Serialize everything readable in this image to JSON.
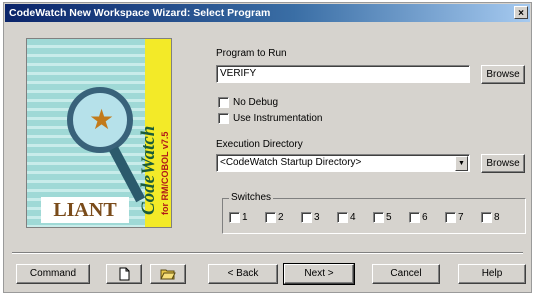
{
  "window": {
    "title": "CodeWatch New Workspace Wizard: Select Program",
    "close_glyph": "×"
  },
  "logo": {
    "brand": "LIANT",
    "product": "CodeWatch",
    "subtitle": "for RM/COBOL v7.5"
  },
  "program": {
    "label": "Program to Run",
    "value": "VERIFY",
    "browse_label": "Browse"
  },
  "options": {
    "no_debug_label": "No Debug",
    "no_debug_checked": false,
    "use_instrumentation_label": "Use Instrumentation",
    "use_instrumentation_checked": false
  },
  "execdir": {
    "label": "Execution Directory",
    "value": "<CodeWatch Startup Directory>",
    "browse_label": "Browse"
  },
  "switches": {
    "label": "Switches",
    "items": [
      "1",
      "2",
      "3",
      "4",
      "5",
      "6",
      "7",
      "8"
    ]
  },
  "footer": {
    "command_label": "Command",
    "back_label": "< Back",
    "next_label": "Next >",
    "cancel_label": "Cancel",
    "help_label": "Help"
  },
  "icons": {
    "new_file": "new-file-icon",
    "open_folder": "open-folder-icon",
    "dropdown": "dropdown-arrow-icon",
    "close": "close-icon"
  }
}
